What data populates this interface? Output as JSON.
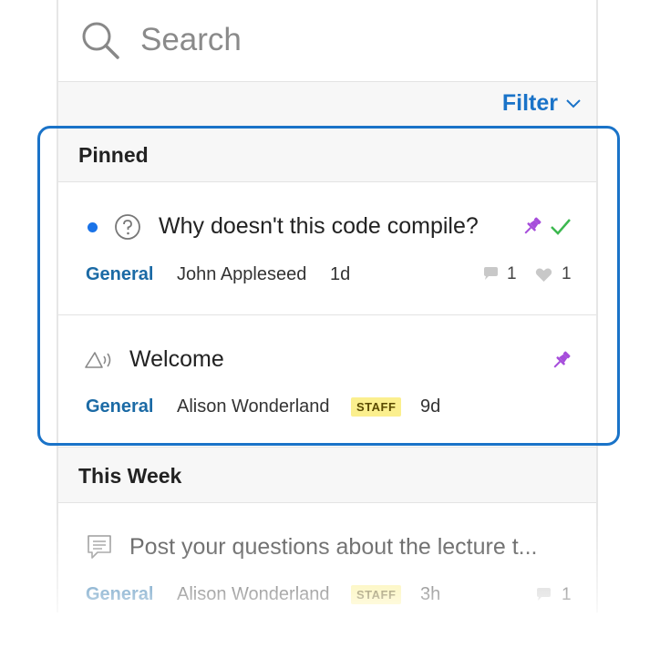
{
  "search": {
    "placeholder": "Search"
  },
  "filter": {
    "label": "Filter"
  },
  "sections": {
    "pinned": {
      "title": "Pinned"
    },
    "this_week": {
      "title": "This Week"
    }
  },
  "threads": [
    {
      "title": "Why doesn't this code compile?",
      "category": "General",
      "author": "John Appleseed",
      "time": "1d",
      "comments": "1",
      "likes": "1",
      "icon": "question-circle-icon",
      "pinned": true,
      "resolved": true,
      "unread": true
    },
    {
      "title": "Welcome",
      "category": "General",
      "author": "Alison Wonderland",
      "badge": "STAFF",
      "time": "9d",
      "icon": "announcement-icon",
      "pinned": true
    },
    {
      "title": "Post your questions about the lecture t...",
      "category": "General",
      "author": "Alison Wonderland",
      "badge": "STAFF",
      "time": "3h",
      "comments": "1",
      "icon": "discussion-icon"
    }
  ],
  "colors": {
    "accent": "#1a73c8",
    "category": "#1b6aa5",
    "pin": "#a64ddb",
    "check": "#3cb84f",
    "staff_badge": "#fbef8e",
    "unread_dot": "#1a73e8"
  }
}
